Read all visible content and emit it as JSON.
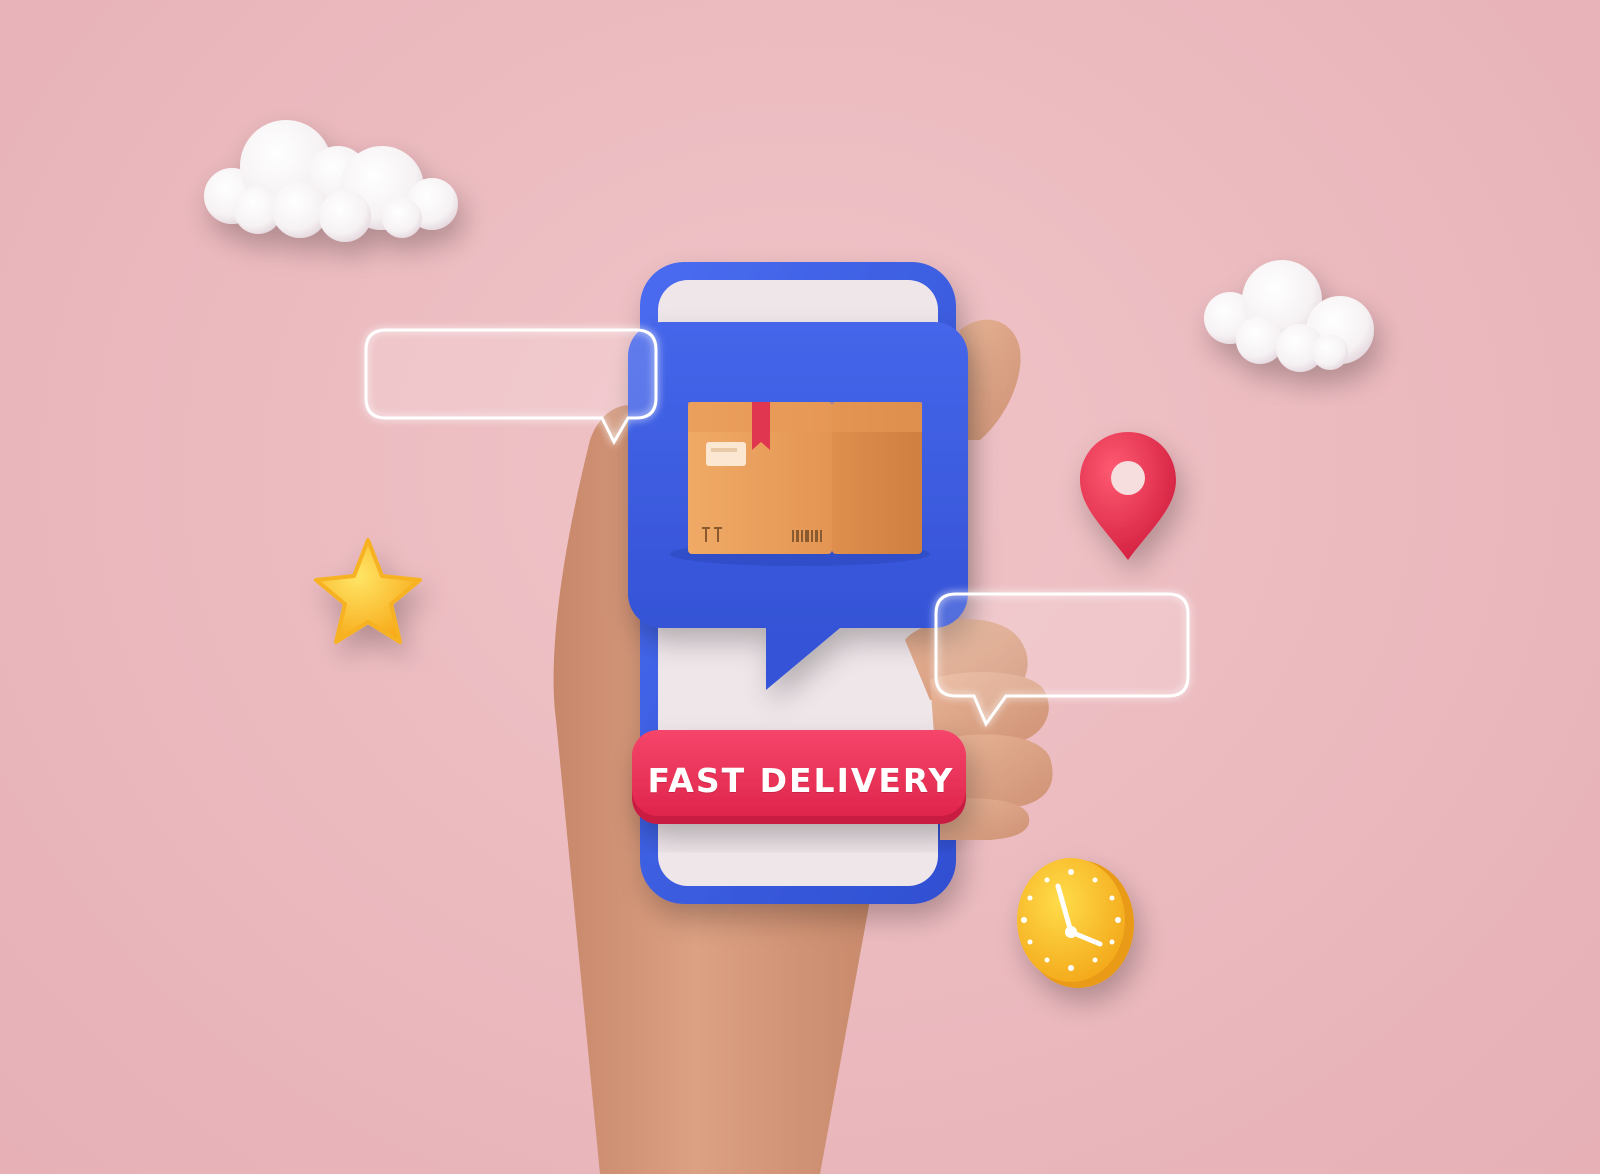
{
  "banner": {
    "text": "FAST DELIVERY"
  },
  "colors": {
    "background": "#eab8bd",
    "phone_frame": "#3b5bdb",
    "screen": "#efe6ea",
    "message_card": "#3e5fe0",
    "banner": "#ee2f55",
    "box": "#e9a15c",
    "ribbon": "#e03650",
    "pin": "#e4334f",
    "star": "#ffc42e",
    "clock": "#ffc22a",
    "cloud": "#ffffff",
    "skin": "#d99b7c"
  },
  "icons": {
    "cloud_left": "cloud-icon",
    "cloud_right": "cloud-icon",
    "star": "star-icon",
    "pin": "location-pin-icon",
    "clock": "clock-icon",
    "box": "package-box-icon"
  }
}
